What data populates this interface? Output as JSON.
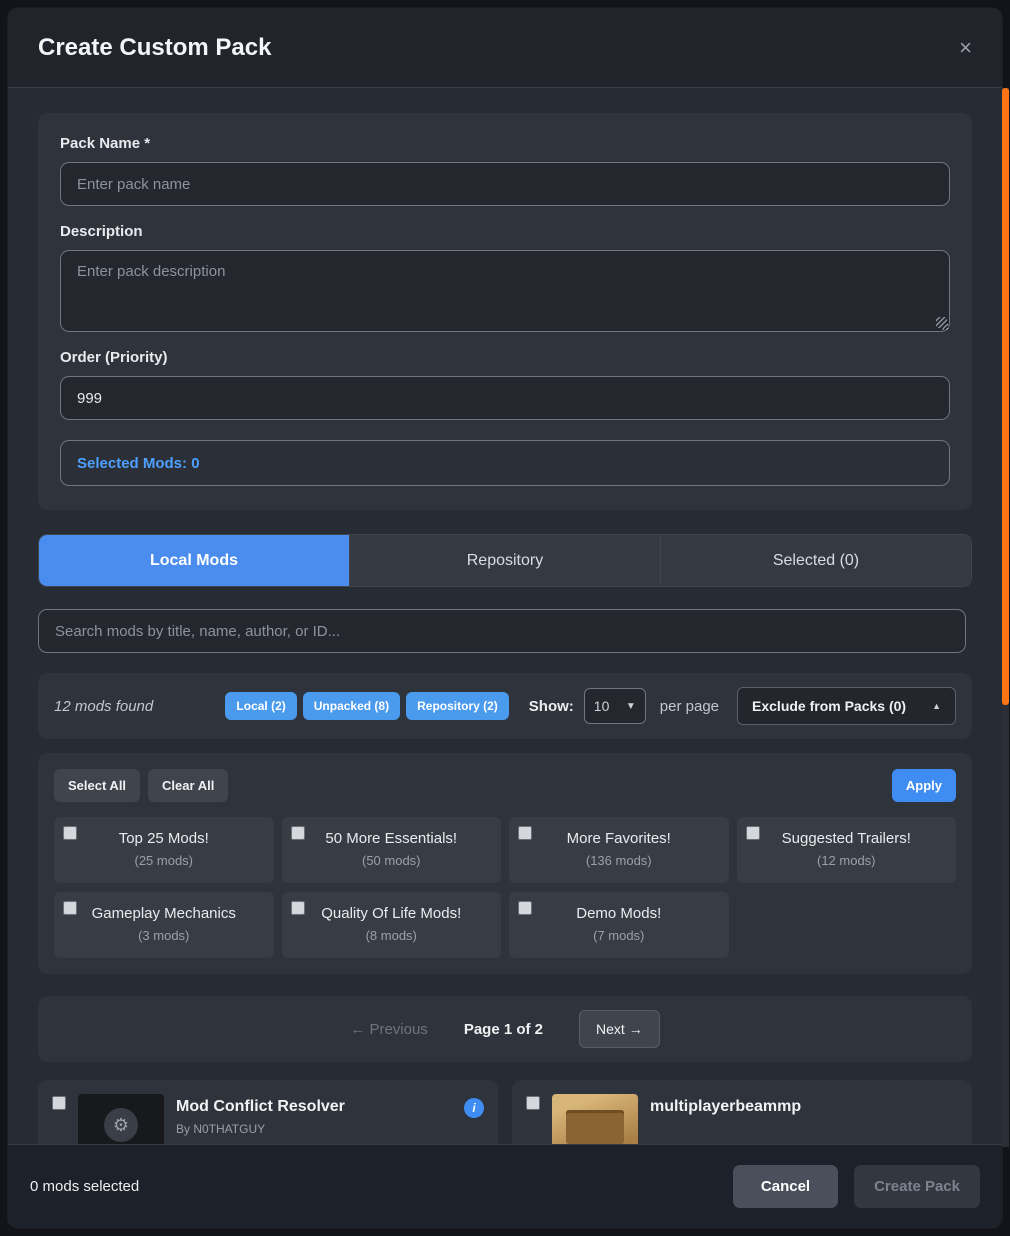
{
  "modal": {
    "title": "Create Custom Pack",
    "close_icon": "×"
  },
  "form": {
    "pack_name_label": "Pack Name *",
    "pack_name_placeholder": "Enter pack name",
    "description_label": "Description",
    "description_placeholder": "Enter pack description",
    "order_label": "Order (Priority)",
    "order_value": "999",
    "selected_mods_label": "Selected Mods: 0"
  },
  "tabs": [
    {
      "label": "Local Mods"
    },
    {
      "label": "Repository"
    },
    {
      "label": "Selected (0)"
    }
  ],
  "search": {
    "placeholder": "Search mods by title, name, author, or ID..."
  },
  "filter_bar": {
    "results_text": "12 mods found",
    "badges": [
      "Local (2)",
      "Unpacked (8)",
      "Repository (2)"
    ],
    "show_label": "Show:",
    "page_size": "10",
    "show_arrow": "▼",
    "per_page_label": "per page",
    "exclude_button": "Exclude from Packs (0)",
    "exclude_arrow": "▲"
  },
  "packs": {
    "select_all": "Select All",
    "clear_all": "Clear All",
    "apply": "Apply",
    "items": [
      {
        "title": "Top 25 Mods!",
        "count": "(25 mods)"
      },
      {
        "title": "50 More Essentials!",
        "count": "(50 mods)"
      },
      {
        "title": "More Favorites!",
        "count": "(136 mods)"
      },
      {
        "title": "Suggested Trailers!",
        "count": "(12 mods)"
      },
      {
        "title": "Gameplay Mechanics",
        "count": "(3 mods)"
      },
      {
        "title": "Quality Of Life Mods!",
        "count": "(8 mods)"
      },
      {
        "title": "Demo Mods!",
        "count": "(7 mods)"
      }
    ]
  },
  "pagination": {
    "previous": "← Previous",
    "page_info": "Page 1 of 2",
    "next": "Next →"
  },
  "mods": [
    {
      "title": "Mod Conflict Resolver",
      "author": "By N0THATGUY"
    },
    {
      "title": "multiplayerbeammp",
      "author": ""
    }
  ],
  "footer": {
    "selected_text": "0 mods selected",
    "cancel": "Cancel",
    "create": "Create Pack"
  },
  "colors": {
    "accent_blue": "#4a8def",
    "scrollbar_orange": "#ff7514"
  }
}
